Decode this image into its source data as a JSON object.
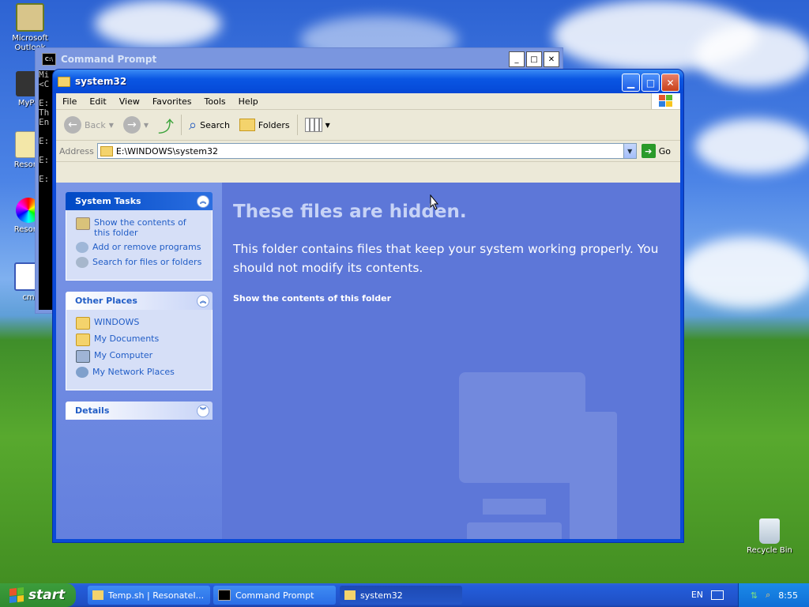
{
  "desktop": {
    "icons": [
      {
        "label": "Microsoft Outlook"
      },
      {
        "label": "MyPa"
      },
      {
        "label": "Resona"
      },
      {
        "label": "Resona"
      },
      {
        "label": "cm"
      },
      {
        "label": "Recycle Bin"
      }
    ]
  },
  "cmd_window": {
    "title": "Command Prompt",
    "lines": [
      "Mi",
      "<C",
      "",
      "E:",
      "Th",
      "En",
      "",
      "E:",
      "",
      "E:",
      "",
      "E:"
    ]
  },
  "explorer": {
    "title": "system32",
    "menu": [
      "File",
      "Edit",
      "View",
      "Favorites",
      "Tools",
      "Help"
    ],
    "toolbar": {
      "back": "Back",
      "search": "Search",
      "folders": "Folders"
    },
    "address": {
      "label": "Address",
      "value": "E:\\WINDOWS\\system32",
      "go": "Go"
    },
    "system_tasks": {
      "header": "System Tasks",
      "items": [
        "Show the contents of this folder",
        "Add or remove programs",
        "Search for files or folders"
      ]
    },
    "other_places": {
      "header": "Other Places",
      "items": [
        "WINDOWS",
        "My Documents",
        "My Computer",
        "My Network Places"
      ]
    },
    "details": {
      "header": "Details"
    },
    "main": {
      "heading": "These files are hidden.",
      "message": "This folder contains files that keep your system working properly. You should not modify its contents.",
      "show_link": "Show the contents of this folder"
    }
  },
  "taskbar": {
    "start": "start",
    "tasks": [
      "Temp.sh | ResonateI...",
      "Command Prompt",
      "system32"
    ],
    "lang": "EN",
    "clock": "8:55"
  },
  "colors": {
    "xp_blue": "#0a4ad8",
    "task_pane": "#6480de",
    "link_blue": "#215dc6"
  }
}
